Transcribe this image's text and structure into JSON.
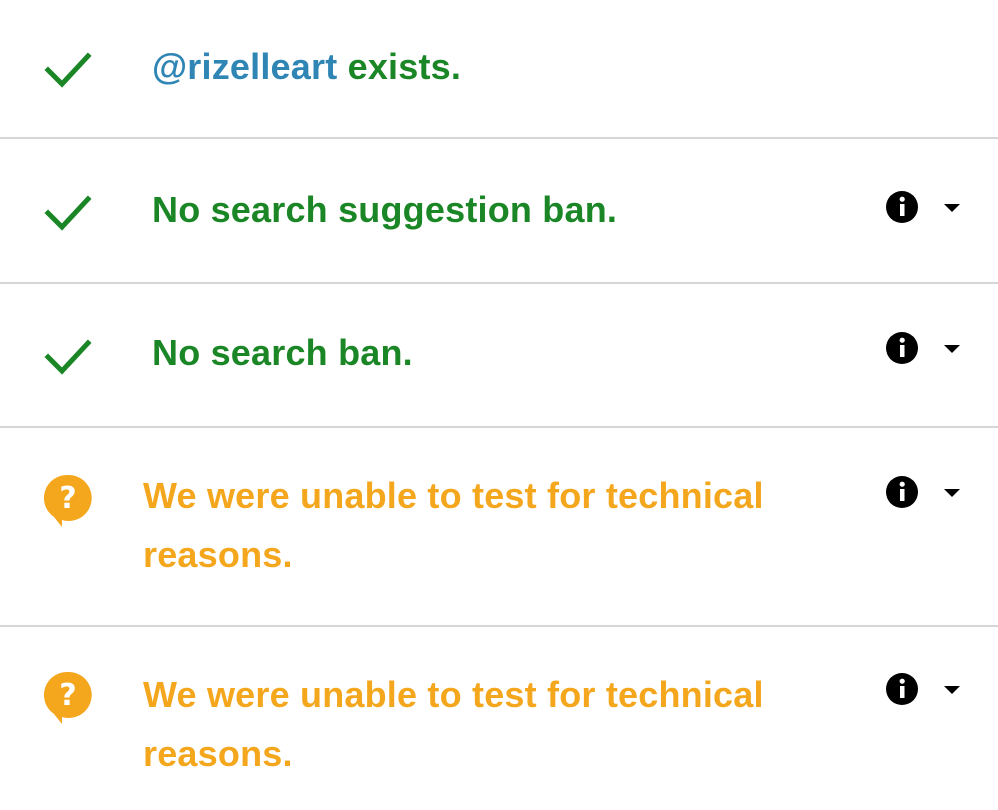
{
  "results": [
    {
      "status": "ok",
      "handle": "@rizelleart",
      "text": " exists."
    },
    {
      "status": "ok",
      "text": "No search suggestion ban."
    },
    {
      "status": "ok",
      "text": "No search ban."
    },
    {
      "status": "unknown",
      "text": "We were unable to test for technical reasons."
    },
    {
      "status": "unknown",
      "text": "We were unable to test for technical reasons."
    }
  ],
  "colors": {
    "ok": "#1a8626",
    "warn": "#f4a61c",
    "handle": "#2f86b5",
    "divider": "#d6d6d6"
  },
  "icons": {
    "ok": "check-icon",
    "unknown": "question-bubble-icon",
    "info": "info-icon",
    "expand": "caret-down-icon"
  }
}
